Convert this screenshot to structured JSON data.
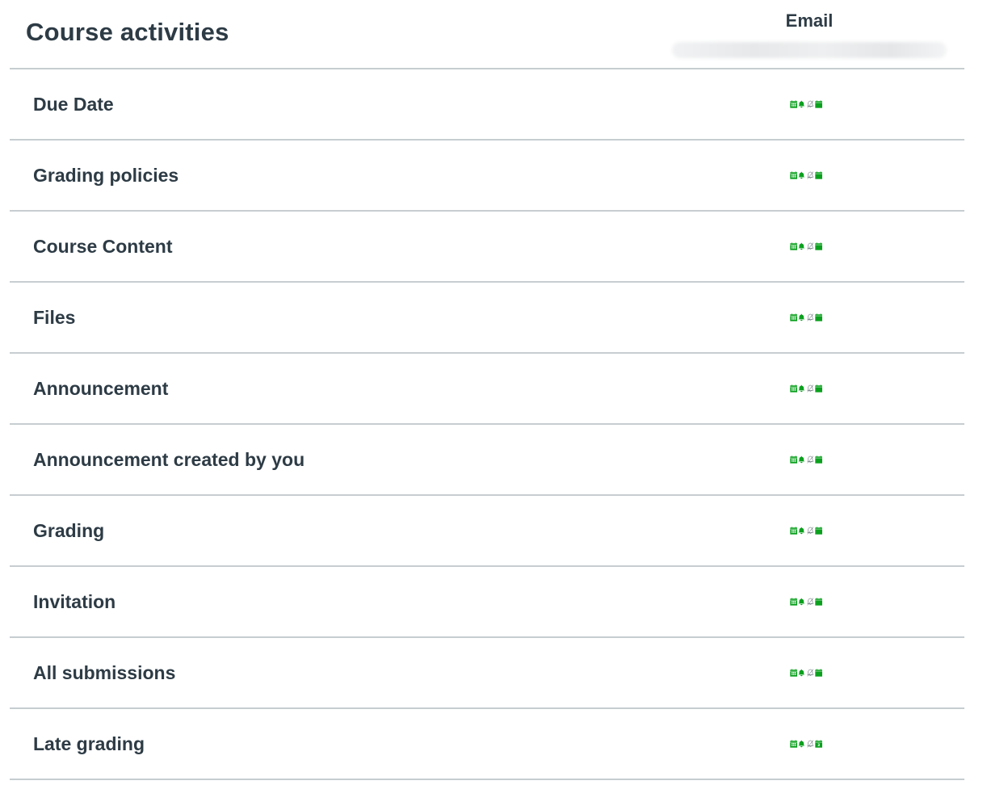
{
  "header": {
    "title": "Course activities",
    "column_label": "Email",
    "column_address": ""
  },
  "colors": {
    "text": "#2d3b45",
    "divider": "#c7cdd1",
    "accent_green": "#0ba01e",
    "muted_icon": "#2d3b45"
  },
  "rows": [
    {
      "label": "Due Date",
      "preference": "calendar",
      "icon": "calendar-icon"
    },
    {
      "label": "Grading policies",
      "preference": "bell-off",
      "icon": "bell-off-icon"
    },
    {
      "label": "Course Content",
      "preference": "bell-on",
      "icon": "bell-icon"
    },
    {
      "label": "Files",
      "preference": "bell-off",
      "icon": "bell-off-icon"
    },
    {
      "label": "Announcement",
      "preference": "bell-off",
      "icon": "bell-off-icon"
    },
    {
      "label": "Announcement created by you",
      "preference": "bell-off",
      "icon": "bell-off-icon"
    },
    {
      "label": "Grading",
      "preference": "bell-on",
      "icon": "bell-icon"
    },
    {
      "label": "Invitation",
      "preference": "bell-off",
      "icon": "bell-off-icon"
    },
    {
      "label": "All submissions",
      "preference": "bell-off",
      "icon": "bell-off-icon"
    },
    {
      "label": "Late grading",
      "preference": "calendar-day",
      "icon": "calendar-day-icon",
      "day": "3"
    }
  ]
}
